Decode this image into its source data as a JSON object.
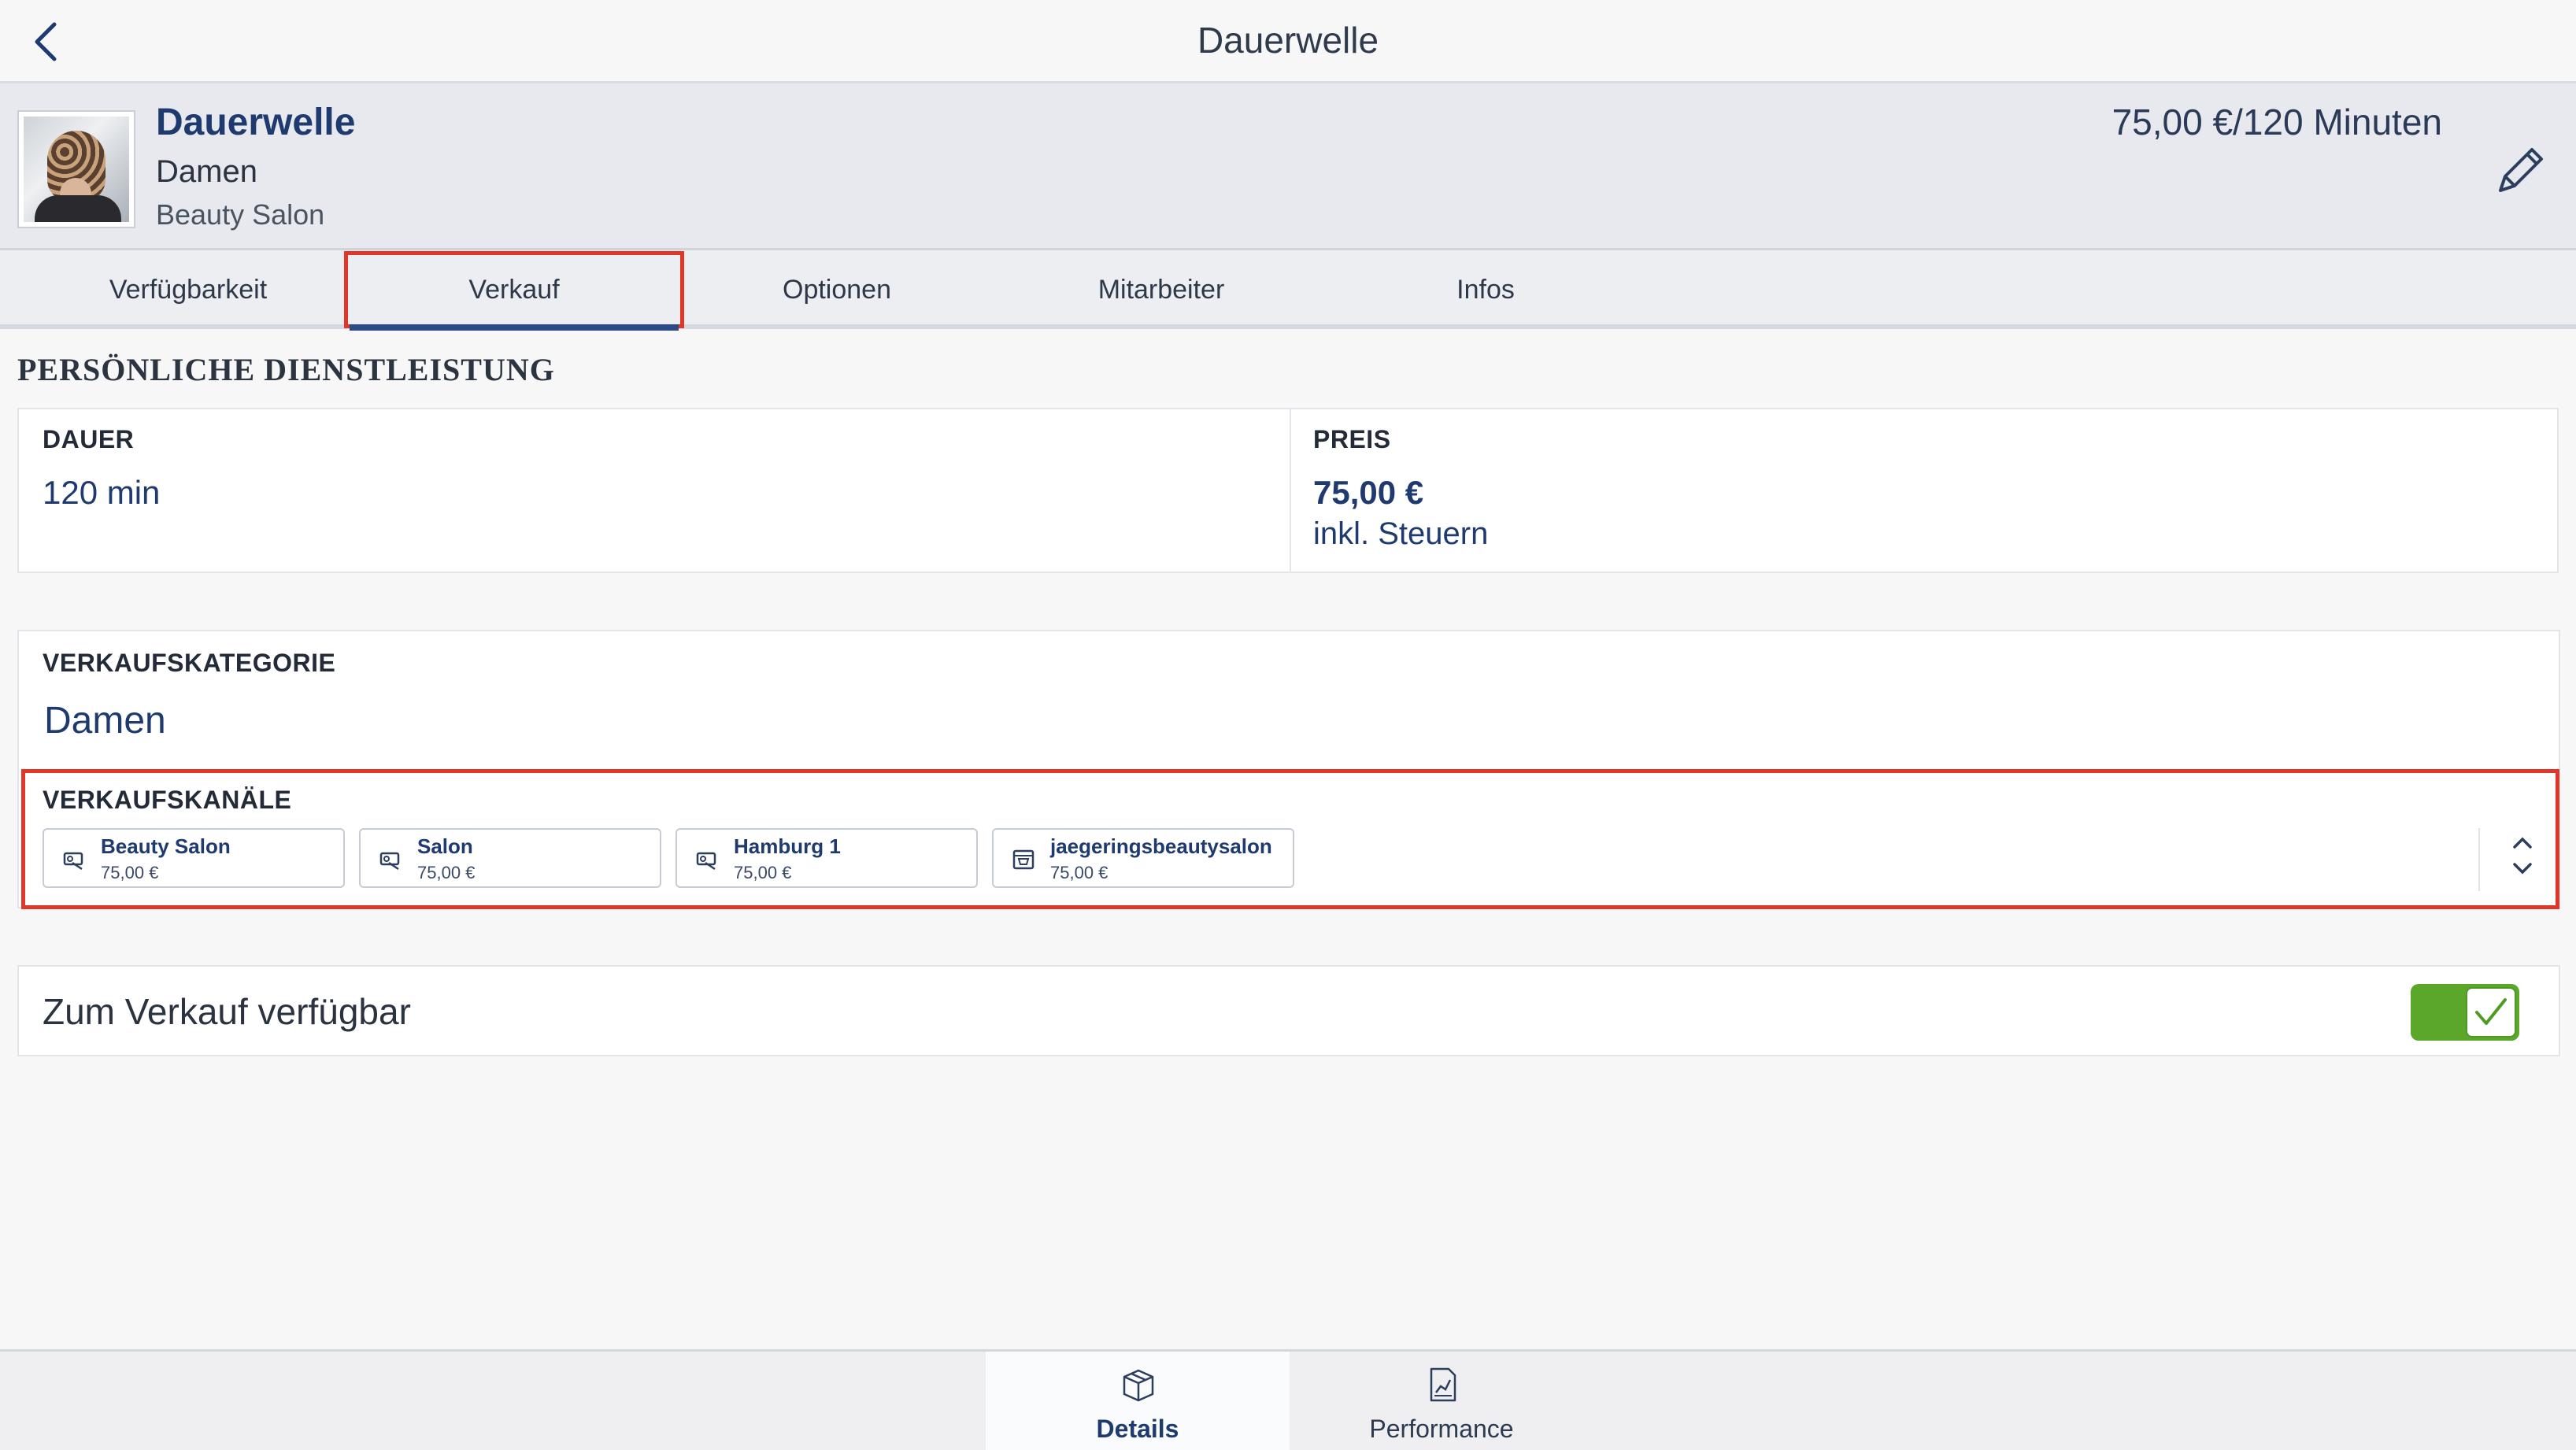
{
  "nav": {
    "title": "Dauerwelle"
  },
  "header": {
    "name": "Dauerwelle",
    "category": "Damen",
    "salon": "Beauty Salon",
    "price_duration": "75,00 €/120 Minuten"
  },
  "tabs": [
    {
      "label": "Verfügbarkeit"
    },
    {
      "label": "Verkauf"
    },
    {
      "label": "Optionen"
    },
    {
      "label": "Mitarbeiter"
    },
    {
      "label": "Infos"
    }
  ],
  "active_tab": "Verkauf",
  "section_title": "PERSÖNLICHE DIENSTLEISTUNG",
  "duration": {
    "label": "DAUER",
    "value": "120 min"
  },
  "price": {
    "label": "PREIS",
    "value": "75,00 €",
    "note": "inkl. Steuern"
  },
  "sales_category": {
    "label": "VERKAUFSKATEGORIE",
    "value": "Damen"
  },
  "sales_channels": {
    "label": "VERKAUFSKANÄLE",
    "chips": [
      {
        "name": "Beauty Salon",
        "price": "75,00 €",
        "icon": "tag-icon"
      },
      {
        "name": "Salon",
        "price": "75,00 €",
        "icon": "tag-icon"
      },
      {
        "name": "Hamburg 1",
        "price": "75,00 €",
        "icon": "tag-icon"
      },
      {
        "name": "jaegeringsbeautysalon",
        "price": "75,00 €",
        "icon": "web-shop-icon"
      }
    ]
  },
  "availability": {
    "label": "Zum Verkauf verfügbar",
    "enabled": true
  },
  "bottom_tabs": [
    {
      "label": "Details",
      "icon": "box-icon"
    },
    {
      "label": "Performance",
      "icon": "chart-document-icon"
    }
  ],
  "colors": {
    "accent": "#1e3a6e",
    "highlight": "#e0372a",
    "toggle_on": "#5aa72a"
  }
}
